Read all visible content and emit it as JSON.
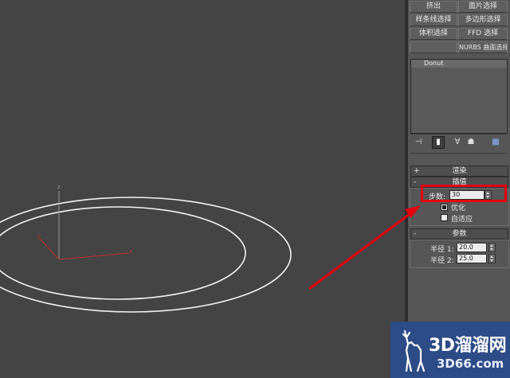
{
  "menu_buttons": [
    {
      "label": "挤出"
    },
    {
      "label": "面片选择"
    },
    {
      "label": "样条线选择"
    },
    {
      "label": "多边形选择"
    },
    {
      "label": "体积选择"
    },
    {
      "label": "FFD 选择"
    },
    {
      "label": "NURBS 曲面选择"
    }
  ],
  "modifier_stack": {
    "items": [
      "Donut"
    ]
  },
  "rollouts": {
    "render": {
      "sign": "+",
      "title": "渲染"
    },
    "interpolation": {
      "sign": "-",
      "title": "插值"
    },
    "parameters": {
      "sign": "-",
      "title": "参数"
    }
  },
  "interpolation": {
    "steps_label": "步数:",
    "steps_value": "30",
    "optimize_label": "优化",
    "optimize_checked": true,
    "adaptive_label": "自适应",
    "adaptive_checked": false
  },
  "parameters": {
    "radius1_label": "半径 1:",
    "radius1_value": "20.0",
    "radius2_label": "半径 2:",
    "radius2_value": "25.0"
  },
  "viewport": {
    "axis_label_z": "z",
    "axis_label_x": "x",
    "axis_label_y": "y"
  },
  "watermark": {
    "line1": "3D溜溜网",
    "line2": "3D66.com"
  },
  "colors": {
    "highlight": "#e4000f",
    "viewport_bg": "#444444",
    "panel_bg": "#565656",
    "watermark_bg": "#2d4b86"
  }
}
